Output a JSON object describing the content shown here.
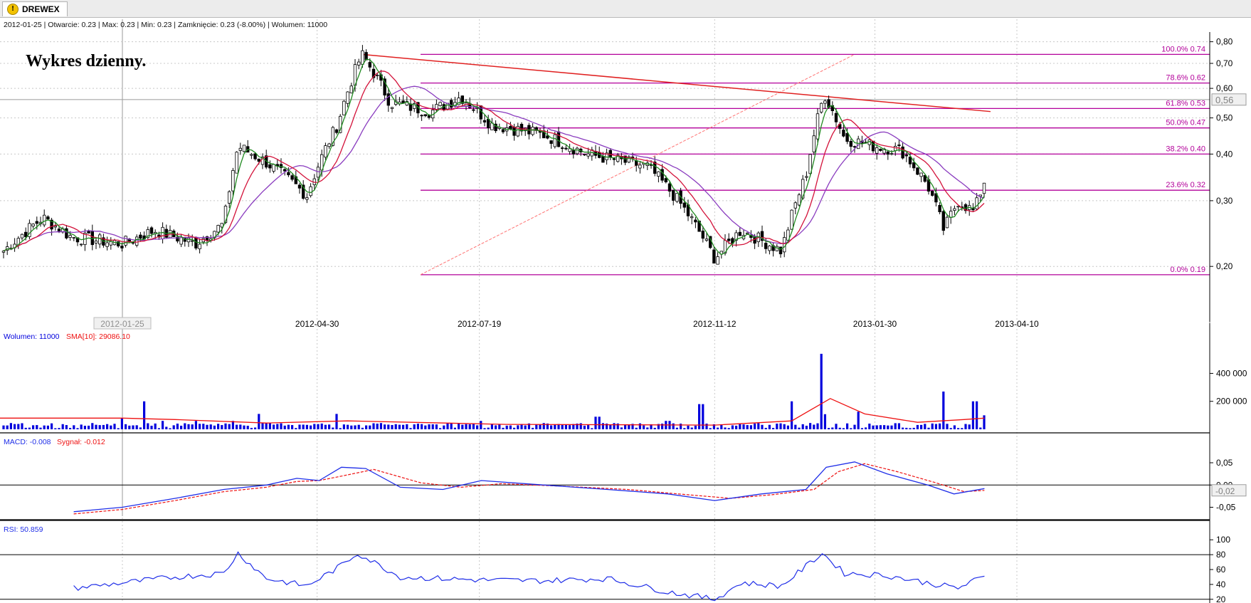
{
  "tab": {
    "icon": "warning-icon",
    "title": "DREWEX"
  },
  "info_bar": "2012-01-25 | Otwarcie: 0.23 | Max: 0.23 | Min: 0.23 | Zamknięcie: 0.23 (-8.00%)  | Wolumen: 11000",
  "annotation": "Wykres dzienny.",
  "colors": {
    "grid": "#c8c8c8",
    "sma_short": "#1f8a1f",
    "sma_mid": "#d3123a",
    "sma_long": "#8a3cbf",
    "fib": "#b3009a",
    "trend": "#e02020",
    "volume": "#0000dd",
    "volume_sma": "#ee1111",
    "macd": "#1f2ee8",
    "signal": "#ee1111",
    "rsi": "#1f2ee8"
  },
  "chart_data": [
    {
      "type": "candlestick",
      "title": "Wykres dzienny.",
      "x_labels": [
        "2012-01-25",
        "2012-04-30",
        "2012-07-19",
        "2012-11-12",
        "2013-01-30",
        "2013-04-10"
      ],
      "y_ticks": [
        "0,20",
        "0,30",
        "0,40",
        "0,50",
        "0,60",
        "0,70",
        "0,80"
      ],
      "ylim": [
        0.16,
        0.82
      ],
      "scale": "log",
      "current_price_label": "0,56",
      "close_approx": [
        [
          "2012-01-25",
          0.23
        ],
        [
          "2012-02-10",
          0.25
        ],
        [
          "2012-03-01",
          0.23
        ],
        [
          "2012-03-15",
          0.26
        ],
        [
          "2012-03-22",
          0.42
        ],
        [
          "2012-04-05",
          0.38
        ],
        [
          "2012-04-25",
          0.31
        ],
        [
          "2012-05-10",
          0.48
        ],
        [
          "2012-05-22",
          0.74
        ],
        [
          "2012-06-05",
          0.55
        ],
        [
          "2012-06-25",
          0.52
        ],
        [
          "2012-07-10",
          0.57
        ],
        [
          "2012-07-25",
          0.48
        ],
        [
          "2012-08-20",
          0.45
        ],
        [
          "2012-09-10",
          0.4
        ],
        [
          "2012-10-10",
          0.37
        ],
        [
          "2012-10-25",
          0.3
        ],
        [
          "2012-11-12",
          0.21
        ],
        [
          "2012-11-25",
          0.25
        ],
        [
          "2012-12-15",
          0.22
        ],
        [
          "2012-12-27",
          0.35
        ],
        [
          "2013-01-05",
          0.58
        ],
        [
          "2013-01-15",
          0.44
        ],
        [
          "2013-01-30",
          0.42
        ],
        [
          "2013-02-12",
          0.41
        ],
        [
          "2013-02-25",
          0.33
        ],
        [
          "2013-03-05",
          0.25
        ],
        [
          "2013-03-12",
          0.3
        ],
        [
          "2013-03-20",
          0.28
        ],
        [
          "2013-03-25",
          0.34
        ]
      ],
      "fibonacci": [
        {
          "label": "100.0% 0.74",
          "value": 0.74
        },
        {
          "label": "78.6% 0.62",
          "value": 0.62
        },
        {
          "label": "61.8% 0.53",
          "value": 0.53
        },
        {
          "label": "50.0% 0.47",
          "value": 0.47
        },
        {
          "label": "38.2% 0.40",
          "value": 0.4
        },
        {
          "label": "23.6% 0.32",
          "value": 0.32
        },
        {
          "label": "0.0% 0.19",
          "value": 0.19
        }
      ],
      "trend_line": [
        [
          "2012-05-22",
          0.74
        ],
        [
          "2013-03-28",
          0.52
        ]
      ]
    },
    {
      "type": "bar",
      "legend": [
        "Wolumen: 11000",
        "SMA[10]: 29086.10"
      ],
      "y_ticks": [
        "200 000",
        "400 000"
      ],
      "ylim": [
        0,
        550000
      ],
      "volume_approx": [
        [
          "2012-01-25",
          80000
        ],
        [
          "2012-02-05",
          200000
        ],
        [
          "2012-02-15",
          60000
        ],
        [
          "2012-03-01",
          200000
        ],
        [
          "2012-03-20",
          200000
        ],
        [
          "2012-04-01",
          110000
        ],
        [
          "2012-05-10",
          110000
        ],
        [
          "2012-06-15",
          30000
        ],
        [
          "2012-07-20",
          60000
        ],
        [
          "2012-09-15",
          90000
        ],
        [
          "2012-10-20",
          60000
        ],
        [
          "2012-11-05",
          180000
        ],
        [
          "2012-12-20",
          200000
        ],
        [
          "2013-01-03",
          540000
        ],
        [
          "2013-01-06",
          360000
        ],
        [
          "2013-01-22",
          420000
        ],
        [
          "2013-02-05",
          90000
        ],
        [
          "2013-03-05",
          270000
        ],
        [
          "2013-03-20",
          200000
        ],
        [
          "2013-03-25",
          100000
        ]
      ],
      "sma_approx": [
        [
          "2012-01-25",
          80000
        ],
        [
          "2012-02-20",
          70000
        ],
        [
          "2012-04-05",
          45000
        ],
        [
          "2012-05-15",
          60000
        ],
        [
          "2012-08-01",
          35000
        ],
        [
          "2012-11-12",
          30000
        ],
        [
          "2012-12-20",
          60000
        ],
        [
          "2013-01-08",
          220000
        ],
        [
          "2013-01-25",
          110000
        ],
        [
          "2013-02-20",
          50000
        ],
        [
          "2013-03-15",
          70000
        ],
        [
          "2013-03-25",
          80000
        ]
      ]
    },
    {
      "type": "line",
      "legend": [
        "MACD: -0.008",
        "Sygnał: -0.012"
      ],
      "y_ticks": [
        "-0,05",
        "0,00",
        "0,05"
      ],
      "current_label": "-0,02",
      "ylim": [
        -0.07,
        0.09
      ],
      "series": [
        {
          "name": "MACD: -0.008",
          "points": [
            [
              "2012-01-01",
              -0.06
            ],
            [
              "2012-01-25",
              -0.05
            ],
            [
              "2012-02-20",
              -0.03
            ],
            [
              "2012-03-15",
              -0.01
            ],
            [
              "2012-04-05",
              0.0
            ],
            [
              "2012-04-20",
              0.015
            ],
            [
              "2012-05-01",
              0.01
            ],
            [
              "2012-05-12",
              0.04
            ],
            [
              "2012-05-24",
              0.037
            ],
            [
              "2012-06-10",
              -0.005
            ],
            [
              "2012-07-01",
              -0.01
            ],
            [
              "2012-07-20",
              0.01
            ],
            [
              "2012-08-20",
              0.0
            ],
            [
              "2012-09-20",
              -0.01
            ],
            [
              "2012-10-20",
              -0.02
            ],
            [
              "2012-11-12",
              -0.035
            ],
            [
              "2012-12-05",
              -0.02
            ],
            [
              "2012-12-27",
              -0.01
            ],
            [
              "2013-01-06",
              0.04
            ],
            [
              "2013-01-20",
              0.052
            ],
            [
              "2013-02-05",
              0.025
            ],
            [
              "2013-02-25",
              0.0
            ],
            [
              "2013-03-10",
              -0.02
            ],
            [
              "2013-03-25",
              -0.008
            ]
          ]
        },
        {
          "name": "Sygnał: -0.012",
          "points": [
            [
              "2012-01-01",
              -0.065
            ],
            [
              "2012-01-25",
              -0.055
            ],
            [
              "2012-02-20",
              -0.035
            ],
            [
              "2012-03-15",
              -0.015
            ],
            [
              "2012-04-05",
              -0.005
            ],
            [
              "2012-04-20",
              0.008
            ],
            [
              "2012-05-01",
              0.01
            ],
            [
              "2012-05-12",
              0.02
            ],
            [
              "2012-05-28",
              0.035
            ],
            [
              "2012-06-20",
              0.005
            ],
            [
              "2012-07-10",
              -0.005
            ],
            [
              "2012-07-30",
              0.003
            ],
            [
              "2012-08-30",
              -0.003
            ],
            [
              "2012-09-30",
              -0.01
            ],
            [
              "2012-10-30",
              -0.022
            ],
            [
              "2012-11-20",
              -0.03
            ],
            [
              "2012-12-10",
              -0.022
            ],
            [
              "2012-12-31",
              -0.01
            ],
            [
              "2013-01-12",
              0.03
            ],
            [
              "2013-01-25",
              0.048
            ],
            [
              "2013-02-10",
              0.03
            ],
            [
              "2013-03-01",
              0.005
            ],
            [
              "2013-03-15",
              -0.015
            ],
            [
              "2013-03-25",
              -0.012
            ]
          ]
        }
      ]
    },
    {
      "type": "line",
      "legend": [
        "RSI: 50.859"
      ],
      "y_ticks": [
        "20",
        "40",
        "60",
        "80",
        "100"
      ],
      "ylim": [
        15,
        105
      ],
      "series": [
        {
          "name": "RSI: 50.859",
          "points": [
            [
              "2012-01-01",
              35
            ],
            [
              "2012-01-25",
              42
            ],
            [
              "2012-02-20",
              50
            ],
            [
              "2012-03-15",
              55
            ],
            [
              "2012-03-22",
              82
            ],
            [
              "2012-04-05",
              48
            ],
            [
              "2012-04-25",
              38
            ],
            [
              "2012-05-10",
              62
            ],
            [
              "2012-05-20",
              82
            ],
            [
              "2012-06-10",
              50
            ],
            [
              "2012-07-19",
              46
            ],
            [
              "2012-08-20",
              45
            ],
            [
              "2012-09-20",
              48
            ],
            [
              "2012-10-20",
              30
            ],
            [
              "2012-11-12",
              20
            ],
            [
              "2012-11-25",
              42
            ],
            [
              "2012-12-15",
              38
            ],
            [
              "2013-01-04",
              82
            ],
            [
              "2013-01-15",
              55
            ],
            [
              "2013-02-05",
              52
            ],
            [
              "2013-03-01",
              40
            ],
            [
              "2013-03-12",
              35
            ],
            [
              "2013-03-20",
              45
            ],
            [
              "2013-03-25",
              51
            ]
          ]
        }
      ]
    }
  ]
}
